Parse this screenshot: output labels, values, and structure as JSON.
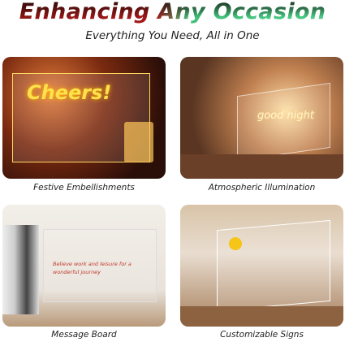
{
  "header": {
    "title": "Enhancing Any Occasion",
    "subtitle": "Everything You Need, All in One"
  },
  "panels": [
    {
      "caption": "Festive Embellishments",
      "photo_text": "Cheers!"
    },
    {
      "caption": "Atmospheric Illumination",
      "photo_text": "good night"
    },
    {
      "caption": "Message Board",
      "photo_text": "Believe work and leisure for a wonderful journey"
    },
    {
      "caption": "Customizable Signs"
    }
  ],
  "colors": {
    "title_red": "#a31818",
    "title_green": "#4ccf88",
    "glow_yellow": "#ffe14a"
  }
}
